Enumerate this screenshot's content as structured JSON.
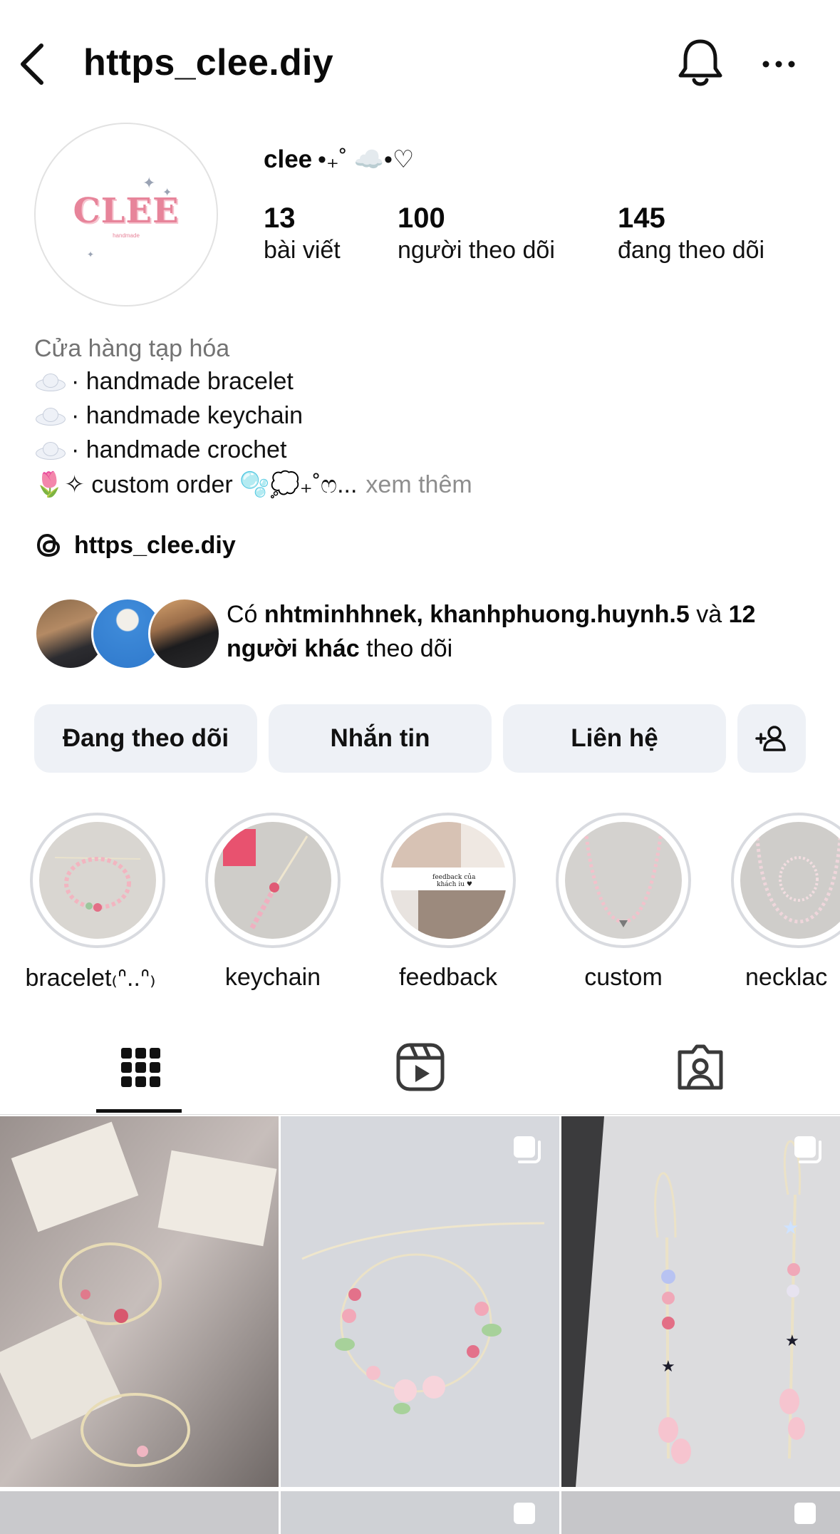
{
  "header": {
    "title": "https_clee.diy",
    "back_icon": "chevron-left-icon",
    "bell_icon": "bell-icon",
    "more_icon": "more-horizontal-icon"
  },
  "profile": {
    "avatar_logo": "CLEE",
    "avatar_tagline": "handmade",
    "display_name": "clee",
    "display_decoration": "•₊˚ ☁️•♡",
    "stats": [
      {
        "value": "13",
        "label": "bài viết"
      },
      {
        "value": "100",
        "label": "người theo dõi"
      },
      {
        "value": "145",
        "label": "đang theo dõi"
      }
    ],
    "category": "Cửa hàng tạp hóa",
    "bio_lines": [
      "· handmade bracelet",
      "· handmade keychain",
      "· handmade crochet"
    ],
    "bio_last": "🌷✧ custom order 🫧💭₊˚ෆ...",
    "bio_more": "xem thêm",
    "threads_handle": "https_clee.diy",
    "mutual": {
      "prefix": "Có",
      "names": "nhtminhhnek, khanhphuong.huynh.5",
      "middle": "và",
      "others": "12 người khác",
      "suffix": "theo dõi"
    }
  },
  "buttons": {
    "following": "Đang theo dõi",
    "message": "Nhắn tin",
    "contact": "Liên hệ",
    "add_user_icon": "add-user-icon"
  },
  "highlights": [
    {
      "label": "bracelet₍ᐢ..ᐢ₎"
    },
    {
      "label": "keychain"
    },
    {
      "label": "feedback"
    },
    {
      "label": "custom"
    },
    {
      "label": "necklac"
    }
  ],
  "tabs": [
    "grid-icon",
    "reels-icon",
    "tagged-icon"
  ],
  "colors": {
    "button_bg": "#eef1f6",
    "secondary_text": "#737373",
    "accent_pink": "#e7849a"
  }
}
